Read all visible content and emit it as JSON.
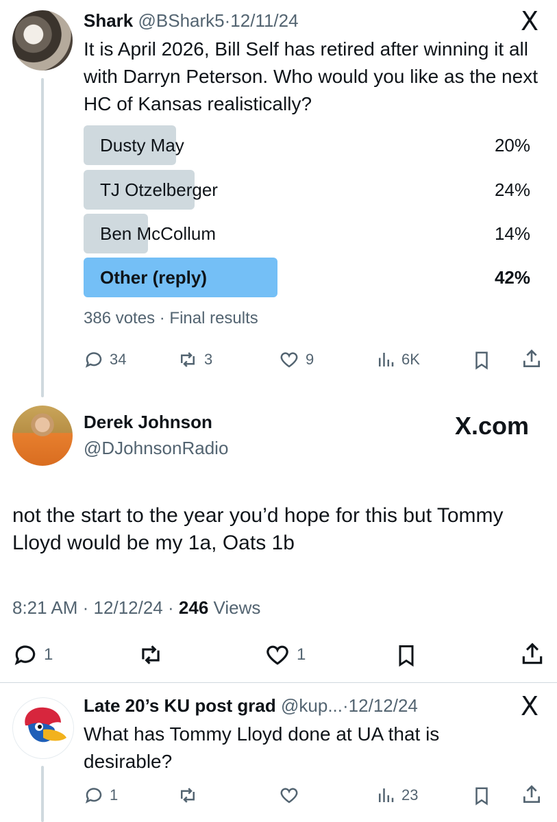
{
  "tweet1": {
    "name": "Shark",
    "handle": "@BShark5",
    "sep": "·",
    "date": "12/11/24",
    "x_logo": "X",
    "text": "It is April 2026, Bill Self has retired after winning it all with Darryn Peterson. Who would you like as the next HC of Kansas realistically?",
    "poll": {
      "options": [
        {
          "label": "Dusty May",
          "percent_label": "20%",
          "fraction": 0.2,
          "winner": false
        },
        {
          "label": "TJ Otzelberger",
          "percent_label": "24%",
          "fraction": 0.24,
          "winner": false
        },
        {
          "label": "Ben McCollum",
          "percent_label": "14%",
          "fraction": 0.14,
          "winner": false
        },
        {
          "label": "Other (reply)",
          "percent_label": "42%",
          "fraction": 0.42,
          "winner": true
        }
      ],
      "footer": "386 votes · Final results"
    },
    "actions": {
      "replies": "34",
      "reposts": "3",
      "likes": "9",
      "views": "6K"
    }
  },
  "tweet2": {
    "name": "Derek Johnson",
    "handle": "@DJohnsonRadio",
    "brand": "X.com",
    "text": "not the start to the year you’d hope for this but Tommy Lloyd would be my 1a, Oats 1b",
    "time": "8:21 AM",
    "date": "12/12/24",
    "sep": "·",
    "views_count": "246",
    "views_label": "Views",
    "actions": {
      "replies": "1",
      "likes": "1"
    }
  },
  "tweet3": {
    "name": "Late 20’s KU post grad",
    "handle": "@kup...",
    "sep": "·",
    "date": "12/12/24",
    "x_logo": "X",
    "text": "What has Tommy Lloyd done at UA that is desirable?",
    "actions": {
      "replies": "1",
      "views": "23"
    }
  },
  "colors": {
    "accent": "#1d9bf0",
    "poll_winner": "#74bff6",
    "poll_bar": "#cfd9de",
    "muted": "#536471"
  },
  "icons": [
    "reply-icon",
    "repost-icon",
    "like-icon",
    "views-icon",
    "bookmark-icon",
    "share-icon",
    "x-logo-icon"
  ]
}
